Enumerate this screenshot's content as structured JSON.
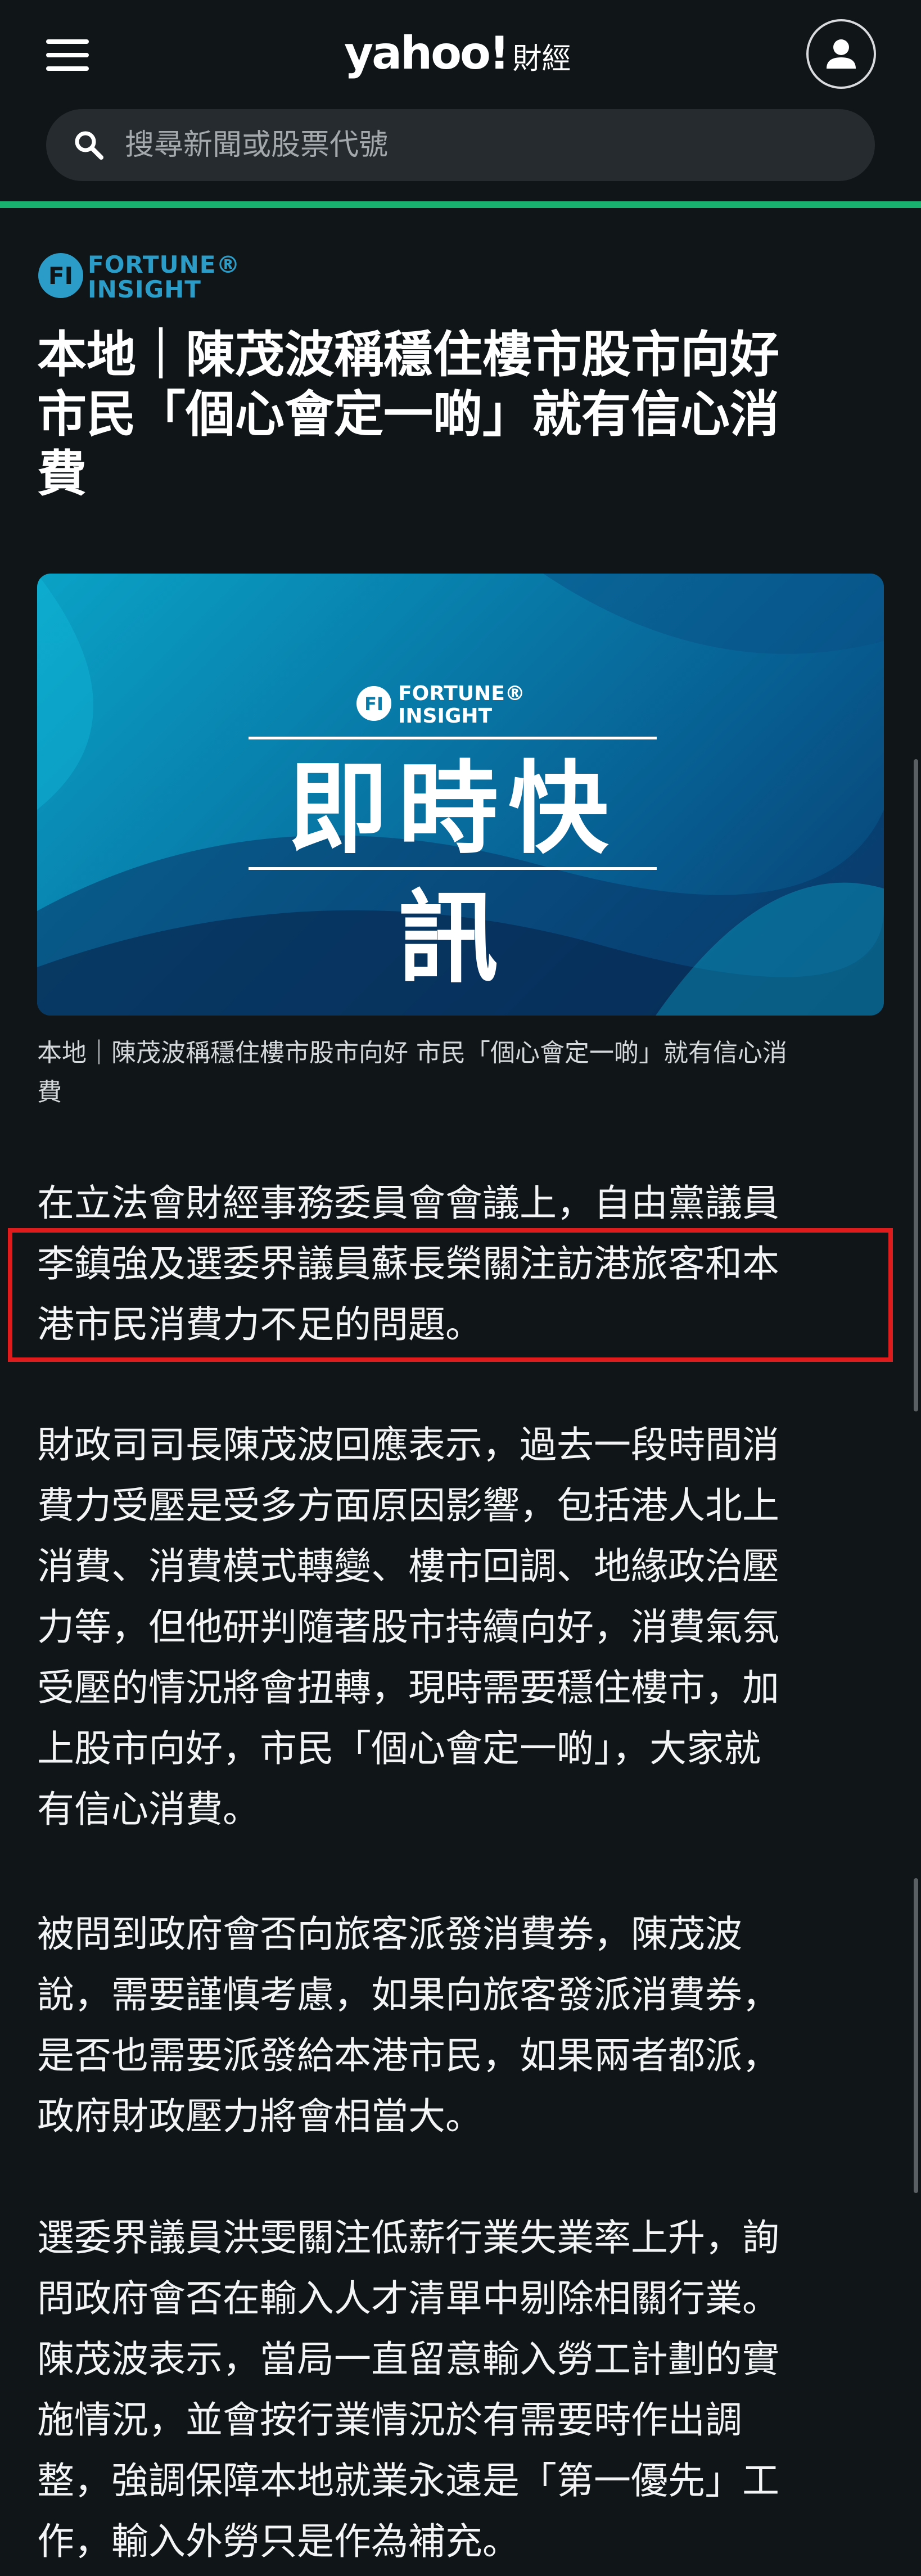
{
  "header": {
    "logo_main": "yahoo!",
    "logo_sub": "財經",
    "search_placeholder": "搜尋新聞或股票代號"
  },
  "article": {
    "source_logo": [
      "FORTUNE®",
      "INSIGHT"
    ],
    "headline_lines": [
      "本地｜陳茂波稱穩住樓市股市向好",
      "市民「個心會定一啲」就有信心消",
      "費"
    ],
    "image": {
      "logo": [
        "FORTUNE®",
        "INSIGHT"
      ],
      "title": "即時快訊"
    },
    "caption_lines": [
      "本地｜陳茂波稱穩住樓市股市向好 市民「個心會定一啲」就有信心消",
      "費"
    ],
    "paragraphs": [
      [
        "在立法會財經事務委員會會議上，自由黨議員",
        "李鎮強及選委界議員蘇長榮關注訪港旅客和本",
        "港市民消費力不足的問題。"
      ],
      [
        "財政司司長陳茂波回應表示，過去一段時間消",
        "費力受壓是受多方面原因影響，包括港人北上",
        "消費、消費模式轉變、樓市回調、地緣政治壓",
        "力等，但他研判隨著股市持續向好，消費氣氛",
        "受壓的情況將會扭轉，現時需要穩住樓市，加",
        "上股市向好，市民「個心會定一啲」，大家就",
        "有信心消費。"
      ],
      [
        "被問到政府會否向旅客派發消費券，陳茂波",
        "說，需要謹慎考慮，如果向旅客發派消費券，",
        "是否也需要派發給本港市民，如果兩者都派，",
        "政府財政壓力將會相當大。"
      ],
      [
        "選委界議員洪雯關注低薪行業失業率上升，詢",
        "問政府會否在輸入人才清單中剔除相關行業。",
        "陳茂波表示，當局一直留意輸入勞工計劃的實",
        "施情況，並會按行業情況於有需要時作出調",
        "整，強調保障本地就業永遠是「第一優先」工",
        "作，輸入外勞只是作為補充。"
      ]
    ]
  },
  "colors": {
    "background": "#101518",
    "accent_line": "#18b36f",
    "highlight": "#e01b1b",
    "brand_blue": "#2b9cc8"
  }
}
